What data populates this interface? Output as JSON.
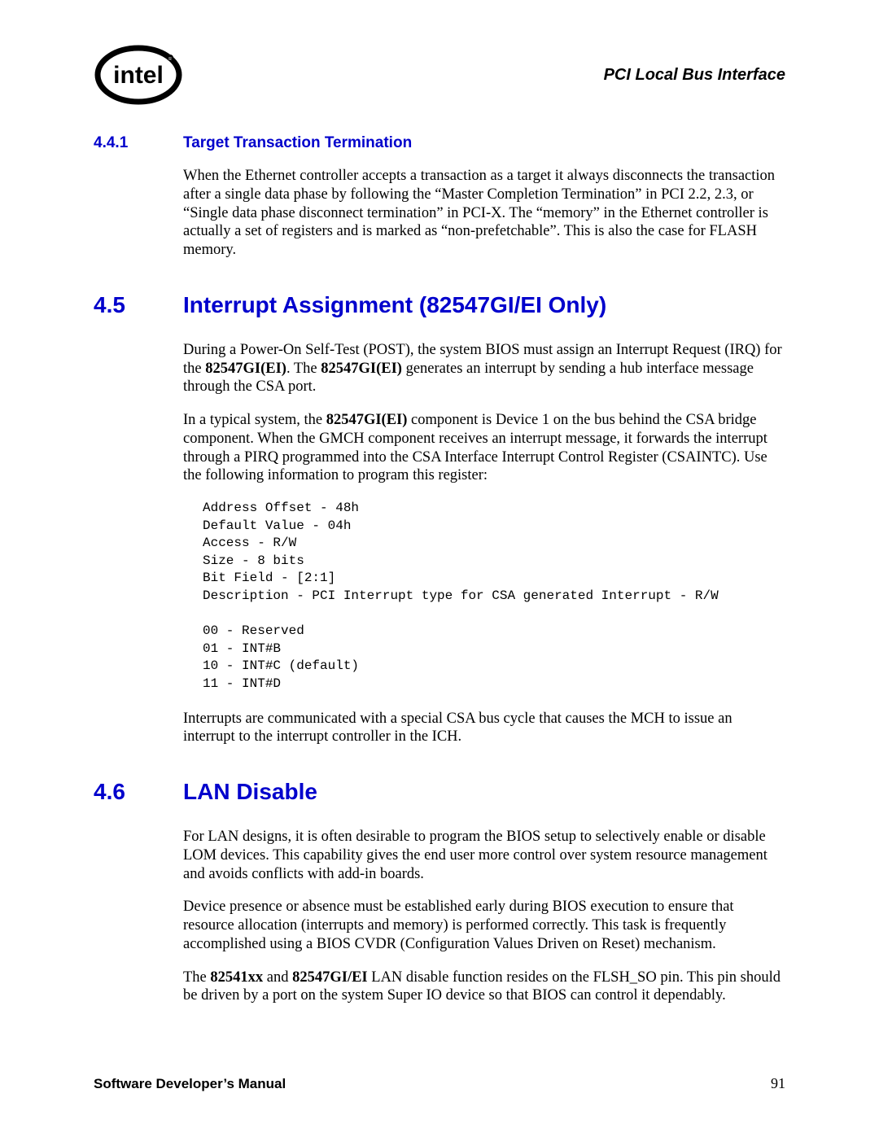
{
  "header": {
    "title": "PCI Local Bus Interface",
    "logo_label": "intel"
  },
  "section441": {
    "num": "4.4.1",
    "title": "Target Transaction Termination",
    "p1": "When the Ethernet controller accepts a transaction as a target it always disconnects the transaction after a single data phase by following the “Master Completion Termination” in PCI 2.2, 2.3, or “Single data phase disconnect termination” in PCI-X. The “memory” in the Ethernet controller is actually a set of registers and is marked as “non-prefetchable”. This is also the case for FLASH memory."
  },
  "section45": {
    "num": "4.5",
    "title": "Interrupt Assignment (82547GI/EI Only)",
    "p1a": "During a Power-On Self-Test (POST), the system BIOS must assign an Interrupt Request (IRQ) for the ",
    "p1b": "82547GI(EI)",
    "p1c": ". The ",
    "p1d": "82547GI(EI)",
    "p1e": " generates an interrupt by sending a hub interface message through the CSA port.",
    "p2a": "In a typical system, the ",
    "p2b": "82547GI(EI)",
    "p2c": " component is Device 1 on the bus behind the CSA bridge component. When the GMCH component receives an interrupt message, it forwards the interrupt through a PIRQ programmed into the CSA Interface Interrupt Control Register (CSAINTC). Use the following information to program this register:",
    "code": "Address Offset - 48h\nDefault Value - 04h\nAccess - R/W\nSize - 8 bits\nBit Field - [2:1]\nDescription - PCI Interrupt type for CSA generated Interrupt - R/W\n\n00 - Reserved\n01 - INT#B\n10 - INT#C (default)\n11 - INT#D",
    "p3": "Interrupts are communicated with a special CSA bus cycle that causes the MCH to issue an interrupt to the interrupt controller in the ICH."
  },
  "section46": {
    "num": "4.6",
    "title": "LAN Disable",
    "p1": "For LAN designs, it is often desirable to program the BIOS setup to selectively enable or disable LOM devices. This capability gives the end user more control over system resource management and avoids conflicts with add-in boards.",
    "p2": "Device presence or absence must be established early during BIOS execution to ensure that resource allocation (interrupts and memory) is performed correctly. This task is frequently accomplished using a BIOS CVDR (Configuration Values Driven on Reset) mechanism.",
    "p3a": "The ",
    "p3b": "82541xx",
    "p3c": " and ",
    "p3d": "82547GI/EI",
    "p3e": " LAN disable function resides on the FLSH_SO pin. This pin should be driven by a port on the system Super IO device so that BIOS can control it dependably."
  },
  "footer": {
    "left": "Software Developer’s Manual",
    "page": "91"
  }
}
